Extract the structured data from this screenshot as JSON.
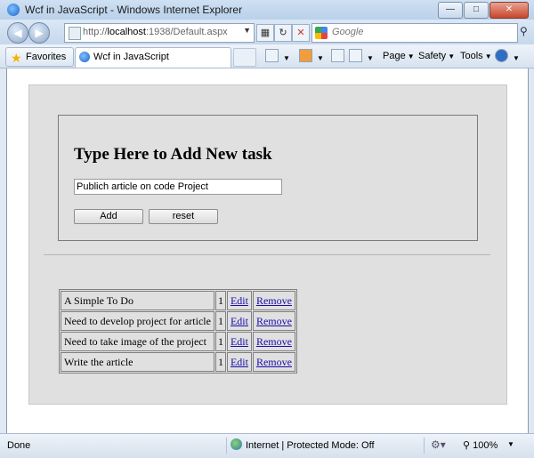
{
  "window": {
    "title": "Wcf in JavaScript - Windows Internet Explorer"
  },
  "address": {
    "url_prefix": "http://",
    "url_host": "localhost",
    "url_rest": ":1938/Default.aspx"
  },
  "search": {
    "placeholder": "Google"
  },
  "toolbar": {
    "favorites_label": "Favorites",
    "tab_label": "Wcf in JavaScript",
    "page_label": "Page",
    "safety_label": "Safety",
    "tools_label": "Tools"
  },
  "form": {
    "heading": "Type Here to Add New task",
    "task_value": "Publich article on code Project",
    "add_label": "Add",
    "reset_label": "reset"
  },
  "tasks": [
    {
      "name": "A Simple To Do",
      "count": "1",
      "edit": "Edit",
      "remove": "Remove"
    },
    {
      "name": "Need to develop project for article",
      "count": "1",
      "edit": "Edit",
      "remove": "Remove"
    },
    {
      "name": "Need to take image of the project",
      "count": "1",
      "edit": "Edit",
      "remove": "Remove"
    },
    {
      "name": "Write the article",
      "count": "1",
      "edit": "Edit",
      "remove": "Remove"
    }
  ],
  "status": {
    "text": "Done",
    "zone": "Internet | Protected Mode: Off",
    "zoom": "100%"
  },
  "icons": [
    "ie-logo-icon",
    "back-icon",
    "forward-icon",
    "page-icon",
    "refresh-icon",
    "stop-icon",
    "google-icon",
    "search-icon",
    "star-icon",
    "home-icon",
    "feeds-icon",
    "mail-icon",
    "print-icon",
    "help-icon",
    "globe-icon",
    "zoom-icon"
  ]
}
